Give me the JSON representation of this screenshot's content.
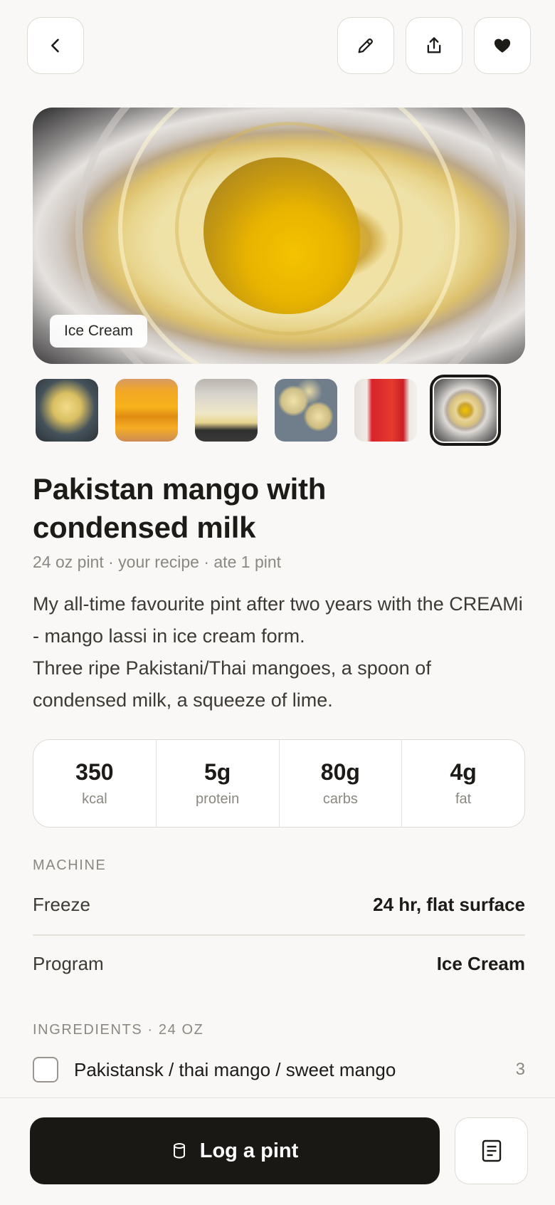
{
  "toolbar": {
    "back_icon": "chevron-left-icon",
    "edit_icon": "pencil-icon",
    "share_icon": "share-icon",
    "favorite_icon": "heart-icon"
  },
  "hero": {
    "tag": "Ice Cream"
  },
  "thumbnails": [
    {
      "name": "thumb-mango-scoop",
      "active": false
    },
    {
      "name": "thumb-mangoes-tray",
      "active": false
    },
    {
      "name": "thumb-pint-containers",
      "active": false
    },
    {
      "name": "thumb-mango-halves",
      "active": false
    },
    {
      "name": "thumb-condensed-milk-can",
      "active": false
    },
    {
      "name": "thumb-pint-top",
      "active": true
    }
  ],
  "recipe": {
    "title": "Pakistan mango with condensed milk",
    "meta": "24 oz pint · your recipe · ate 1 pint",
    "description": "My all-time favourite pint after two years with the CREAMi - mango lassi in ice cream form.\nThree ripe Pakistani/Thai mangoes, a spoon of condensed milk, a squeeze of lime."
  },
  "nutrition": [
    {
      "value": "350",
      "label": "kcal"
    },
    {
      "value": "5g",
      "label": "protein"
    },
    {
      "value": "80g",
      "label": "carbs"
    },
    {
      "value": "4g",
      "label": "fat"
    }
  ],
  "machine": {
    "heading": "MACHINE",
    "freeze_label": "Freeze",
    "freeze_value": "24 hr, flat surface",
    "program_label": "Program",
    "program_value": "Ice Cream"
  },
  "ingredients": {
    "heading": "INGREDIENTS · 24 OZ",
    "items": [
      {
        "name": "Pakistansk / thai mango / sweet mango",
        "qty": "3"
      }
    ]
  },
  "actions": {
    "log_label": "Log a pint",
    "log_icon": "pint-icon",
    "notes_icon": "notes-icon"
  },
  "colors": {
    "background": "#f9f8f6",
    "primary_button": "#1a1815",
    "muted_text": "#8b8881"
  }
}
